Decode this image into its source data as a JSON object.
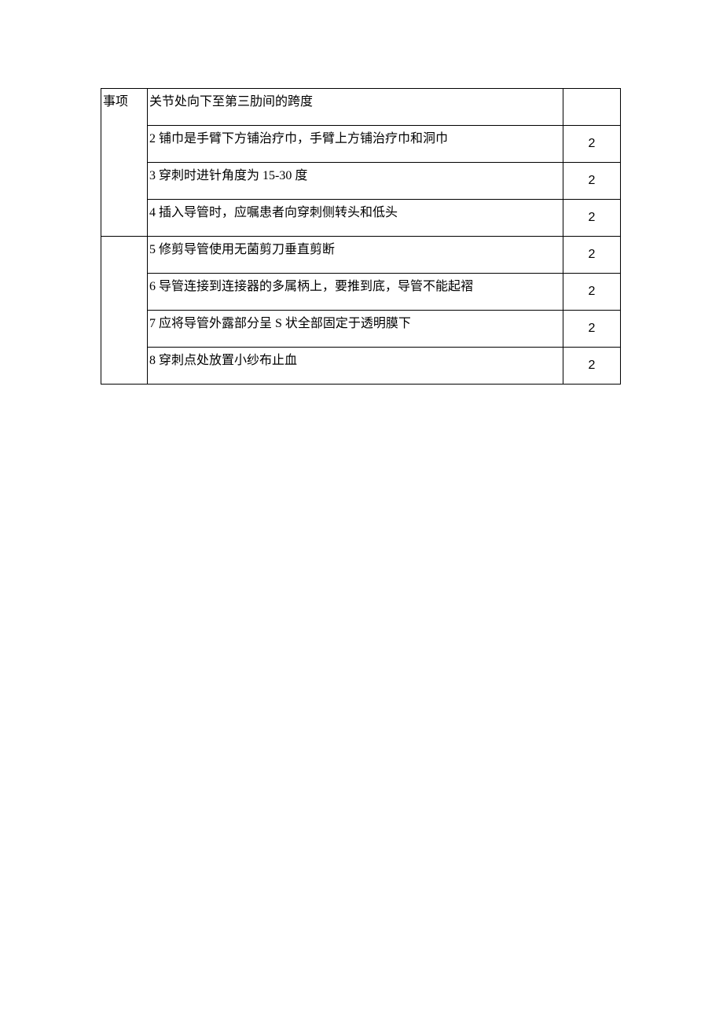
{
  "table": {
    "col1_header": "事项",
    "rows": [
      {
        "desc": "关节处向下至第三肋间的跨度",
        "score": ""
      },
      {
        "desc": "2 铺巾是手臂下方铺治疗巾，手臂上方铺治疗巾和洞巾",
        "score": "2"
      },
      {
        "desc": "3 穿刺时进针角度为 15-30 度",
        "score": "2"
      },
      {
        "desc": "4 插入导管时，应嘱患者向穿刺侧转头和低头",
        "score": "2"
      },
      {
        "desc": "5 修剪导管使用无菌剪刀垂直剪断",
        "score": "2"
      },
      {
        "desc": "6 导管连接到连接器的多属柄上，要推到底，导管不能起褶",
        "score": "2"
      },
      {
        "desc": "7 应将导管外露部分呈 S 状全部固定于透明膜下",
        "score": "2"
      },
      {
        "desc": "8 穿刺点处放置小纱布止血",
        "score": "2"
      }
    ]
  }
}
